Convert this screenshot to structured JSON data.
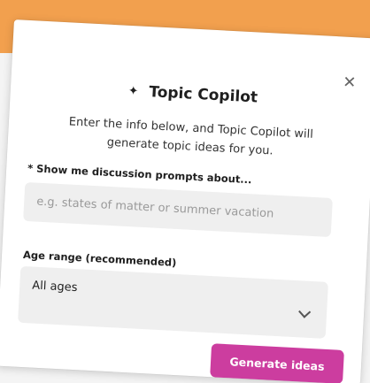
{
  "dialog": {
    "title": "Topic Copilot",
    "sparkle_glyph": "✦",
    "subtitle": "Enter the info below, and Topic Copilot will generate topic ideas for you.",
    "close_glyph": "✕"
  },
  "form": {
    "topic_label": "* Show me discussion prompts about...",
    "topic_placeholder": "e.g. states of matter or summer vacation",
    "age_label": "Age range (recommended)",
    "age_selected": "All ages",
    "submit_label": "Generate ideas"
  },
  "colors": {
    "backdrop_accent": "#f2a04e",
    "primary_button": "#cc3d9f",
    "input_bg": "#efefef"
  },
  "icons": {
    "sparkle": "sparkle-icon",
    "close": "close-icon",
    "dropdown": "chevron-down-icon"
  }
}
